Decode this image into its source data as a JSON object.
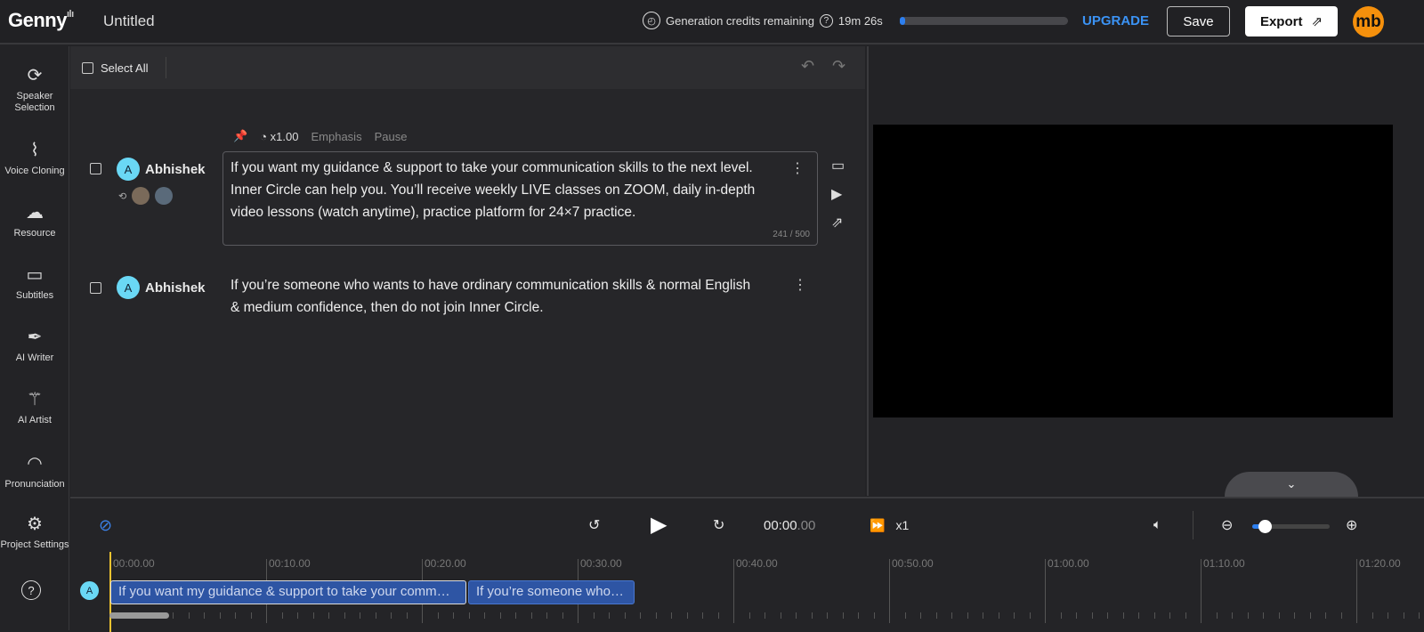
{
  "header": {
    "logo": "Genny",
    "title": "Untitled",
    "credits_label": "Generation credits remaining",
    "credits_time": "19m 26s",
    "credits_fraction": 0.03,
    "upgrade": "UPGRADE",
    "save": "Save",
    "export": "Export",
    "avatar": "mb",
    "accent": "#3b93f5"
  },
  "sidebar": {
    "items": [
      {
        "label": "Speaker Selection",
        "icon": "speaker-swap-icon"
      },
      {
        "label": "Voice Cloning",
        "icon": "dna-icon"
      },
      {
        "label": "Resource",
        "icon": "cloud-upload-icon"
      },
      {
        "label": "Subtitles",
        "icon": "subtitles-icon"
      },
      {
        "label": "AI Writer",
        "icon": "feather-icon"
      },
      {
        "label": "AI Artist",
        "icon": "magic-wand-icon"
      },
      {
        "label": "Pronunciation",
        "icon": "lips-icon"
      },
      {
        "label": "Project Settings",
        "icon": "gear-icon"
      }
    ],
    "help": "?"
  },
  "editor": {
    "select_all": "Select All",
    "speed": "x1.00",
    "emphasis": "Emphasis",
    "pause": "Pause",
    "blocks": [
      {
        "speaker": "Abhishek",
        "initial": "A",
        "text": "If you want my guidance & support to take your communication skills to the next level. Inner Circle can help you. You’ll receive weekly LIVE classes on ZOOM, daily in-depth video lessons (watch anytime), practice platform for 24×7 practice.",
        "count": "241 / 500"
      },
      {
        "speaker": "Abhishek",
        "initial": "A",
        "text": "If you’re someone who wants to have ordinary communication skills & normal English & medium confidence, then do not join Inner Circle."
      }
    ]
  },
  "player": {
    "time": "00:00",
    "time_frac": ".00",
    "speed": "x1",
    "zoom_fraction": 0.1
  },
  "timeline": {
    "labels": [
      "00:00.00",
      "00:10.00",
      "00:20.00",
      "00:30.00",
      "00:40.00",
      "00:50.00",
      "01:00.00",
      "01:10.00",
      "01:20.00"
    ],
    "track_initial": "A",
    "clips": [
      "If you want my guidance & support to take your comm…",
      "If you’re someone who…"
    ]
  }
}
